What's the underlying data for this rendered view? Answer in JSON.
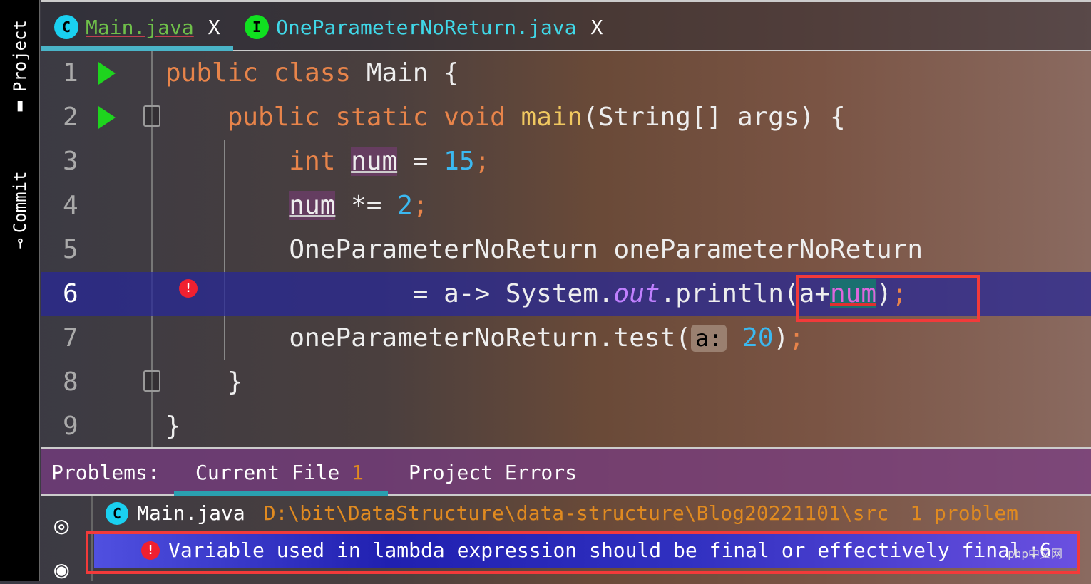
{
  "sidebar": {
    "items": [
      {
        "label": "Project",
        "icon": "folder-icon"
      },
      {
        "label": "Commit",
        "icon": "commit-icon"
      }
    ]
  },
  "tabs": [
    {
      "label": "Main.java",
      "icon": "C",
      "color": "#6fc04a",
      "active": true
    },
    {
      "label": "OneParameterNoReturn.java",
      "icon": "I",
      "color": "#40d8e8",
      "active": false
    }
  ],
  "tab_close": "X",
  "code": {
    "lines": [
      {
        "n": "1",
        "t": [
          [
            "public class ",
            "kw"
          ],
          [
            "Main {",
            ""
          ]
        ],
        "run": true
      },
      {
        "n": "2",
        "t": [
          [
            "    "
          ],
          [
            "public static void ",
            "kw"
          ],
          [
            "main",
            "fn"
          ],
          [
            "(String[] args) {",
            ""
          ]
        ],
        "run": true
      },
      {
        "n": "3",
        "t": [
          [
            "        "
          ],
          [
            "int ",
            "kw"
          ],
          [
            "num",
            "var"
          ],
          [
            " = ",
            ""
          ],
          [
            "15",
            "num"
          ],
          [
            ";",
            "semi"
          ]
        ]
      },
      {
        "n": "4",
        "t": [
          [
            "        "
          ],
          [
            "num",
            "var"
          ],
          [
            " *= ",
            ""
          ],
          [
            "2",
            "num"
          ],
          [
            ";",
            "semi"
          ]
        ]
      },
      {
        "n": "5",
        "t": [
          [
            "        OneParameterNoReturn oneParameterNoReturn",
            ""
          ]
        ]
      },
      {
        "n": "6",
        "t": [
          [
            "                = a-> System.",
            ""
          ],
          [
            "out",
            "st"
          ],
          [
            ".println(a+",
            ""
          ],
          [
            "num",
            "errnum"
          ],
          [
            ")",
            ""
          ],
          [
            ";",
            "semi"
          ]
        ],
        "current": true,
        "error": true
      },
      {
        "n": "7",
        "t": [
          [
            "        oneParameterNoReturn.test(",
            ""
          ],
          [
            "a:",
            "hint"
          ],
          [
            " "
          ],
          [
            "20",
            "num"
          ],
          [
            ")",
            ""
          ],
          [
            ";",
            "semi"
          ]
        ]
      },
      {
        "n": "8",
        "t": [
          [
            "    }",
            ""
          ]
        ]
      },
      {
        "n": "9",
        "t": [
          [
            "}",
            ""
          ]
        ]
      }
    ]
  },
  "problems": {
    "label": "Problems:",
    "tabs": [
      {
        "label": "Current File",
        "count": "1"
      },
      {
        "label": "Project Errors"
      }
    ],
    "file": {
      "name": "Main.java",
      "path": "D:\\bit\\DataStructure\\data-structure\\Blog20221101\\src",
      "count": "1 problem"
    },
    "error": {
      "message": "Variable used in lambda expression should be final or effectively final",
      "line": ":6"
    }
  },
  "watermark": "php中文网",
  "colors": {
    "accent": "#4ab4c8",
    "error": "#f23a3a",
    "selection": "#2828a0"
  }
}
